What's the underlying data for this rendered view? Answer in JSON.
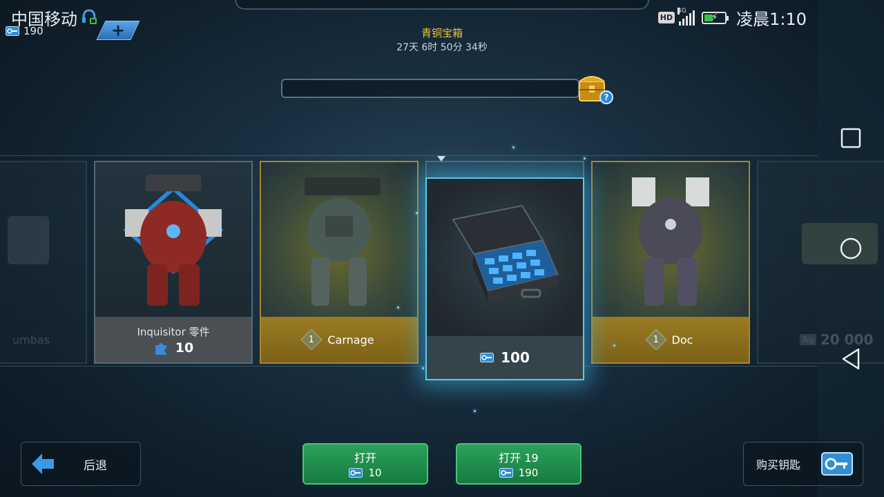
{
  "status_bar": {
    "carrier": "中国移动",
    "hd": "HD",
    "network": "4G",
    "clock": "凌晨1:10"
  },
  "player": {
    "key_count": "190"
  },
  "chest": {
    "title": "青铜宝箱",
    "timer": "27天 6时 50分 34秒",
    "help": "?",
    "progress": 0
  },
  "carousel": {
    "items": [
      {
        "name": "umbas",
        "type": "faded-left"
      },
      {
        "name": "Inquisitor 零件",
        "cost": "10",
        "type": "parts"
      },
      {
        "name": "Carnage",
        "level": "1",
        "type": "robot"
      },
      {
        "name": "",
        "cost": "100",
        "type": "keys-featured"
      },
      {
        "name": "Doc",
        "level": "1",
        "type": "robot"
      },
      {
        "name": "20 000",
        "currency": "Ag",
        "type": "faded-right"
      }
    ]
  },
  "buttons": {
    "back": "后退",
    "open_single": {
      "label": "打开",
      "cost": "10"
    },
    "open_multi": {
      "label": "打开 19",
      "cost": "190"
    },
    "buy_keys": "购买钥匙"
  },
  "colors": {
    "gold": "#a8872a",
    "green": "#2ba15a",
    "highlight": "#5ec8ea",
    "title_gold": "#f0c23a"
  },
  "icons": [
    "headset-icon",
    "hd-icon",
    "signal-icon",
    "battery-icon",
    "key-icon",
    "plus-icon",
    "chest-icon",
    "help-icon",
    "puzzle-icon",
    "diamond-level-icon",
    "back-arrow-icon",
    "keycard-icon",
    "recent-apps-icon",
    "home-icon",
    "back-nav-icon"
  ]
}
